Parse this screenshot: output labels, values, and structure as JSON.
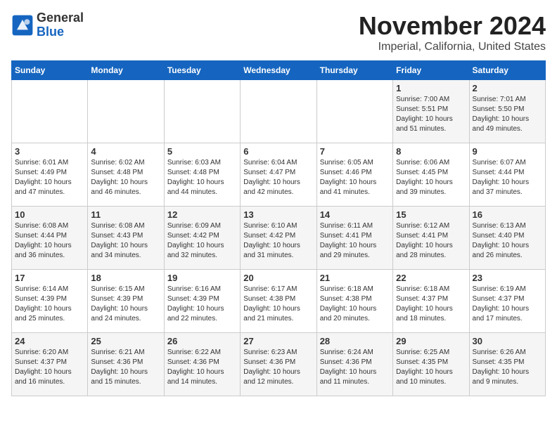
{
  "logo": {
    "line1": "General",
    "line2": "Blue"
  },
  "title": "November 2024",
  "location": "Imperial, California, United States",
  "days_of_week": [
    "Sunday",
    "Monday",
    "Tuesday",
    "Wednesday",
    "Thursday",
    "Friday",
    "Saturday"
  ],
  "weeks": [
    [
      {
        "day": "",
        "info": ""
      },
      {
        "day": "",
        "info": ""
      },
      {
        "day": "",
        "info": ""
      },
      {
        "day": "",
        "info": ""
      },
      {
        "day": "",
        "info": ""
      },
      {
        "day": "1",
        "info": "Sunrise: 7:00 AM\nSunset: 5:51 PM\nDaylight: 10 hours\nand 51 minutes."
      },
      {
        "day": "2",
        "info": "Sunrise: 7:01 AM\nSunset: 5:50 PM\nDaylight: 10 hours\nand 49 minutes."
      }
    ],
    [
      {
        "day": "3",
        "info": "Sunrise: 6:01 AM\nSunset: 4:49 PM\nDaylight: 10 hours\nand 47 minutes."
      },
      {
        "day": "4",
        "info": "Sunrise: 6:02 AM\nSunset: 4:48 PM\nDaylight: 10 hours\nand 46 minutes."
      },
      {
        "day": "5",
        "info": "Sunrise: 6:03 AM\nSunset: 4:48 PM\nDaylight: 10 hours\nand 44 minutes."
      },
      {
        "day": "6",
        "info": "Sunrise: 6:04 AM\nSunset: 4:47 PM\nDaylight: 10 hours\nand 42 minutes."
      },
      {
        "day": "7",
        "info": "Sunrise: 6:05 AM\nSunset: 4:46 PM\nDaylight: 10 hours\nand 41 minutes."
      },
      {
        "day": "8",
        "info": "Sunrise: 6:06 AM\nSunset: 4:45 PM\nDaylight: 10 hours\nand 39 minutes."
      },
      {
        "day": "9",
        "info": "Sunrise: 6:07 AM\nSunset: 4:44 PM\nDaylight: 10 hours\nand 37 minutes."
      }
    ],
    [
      {
        "day": "10",
        "info": "Sunrise: 6:08 AM\nSunset: 4:44 PM\nDaylight: 10 hours\nand 36 minutes."
      },
      {
        "day": "11",
        "info": "Sunrise: 6:08 AM\nSunset: 4:43 PM\nDaylight: 10 hours\nand 34 minutes."
      },
      {
        "day": "12",
        "info": "Sunrise: 6:09 AM\nSunset: 4:42 PM\nDaylight: 10 hours\nand 32 minutes."
      },
      {
        "day": "13",
        "info": "Sunrise: 6:10 AM\nSunset: 4:42 PM\nDaylight: 10 hours\nand 31 minutes."
      },
      {
        "day": "14",
        "info": "Sunrise: 6:11 AM\nSunset: 4:41 PM\nDaylight: 10 hours\nand 29 minutes."
      },
      {
        "day": "15",
        "info": "Sunrise: 6:12 AM\nSunset: 4:41 PM\nDaylight: 10 hours\nand 28 minutes."
      },
      {
        "day": "16",
        "info": "Sunrise: 6:13 AM\nSunset: 4:40 PM\nDaylight: 10 hours\nand 26 minutes."
      }
    ],
    [
      {
        "day": "17",
        "info": "Sunrise: 6:14 AM\nSunset: 4:39 PM\nDaylight: 10 hours\nand 25 minutes."
      },
      {
        "day": "18",
        "info": "Sunrise: 6:15 AM\nSunset: 4:39 PM\nDaylight: 10 hours\nand 24 minutes."
      },
      {
        "day": "19",
        "info": "Sunrise: 6:16 AM\nSunset: 4:39 PM\nDaylight: 10 hours\nand 22 minutes."
      },
      {
        "day": "20",
        "info": "Sunrise: 6:17 AM\nSunset: 4:38 PM\nDaylight: 10 hours\nand 21 minutes."
      },
      {
        "day": "21",
        "info": "Sunrise: 6:18 AM\nSunset: 4:38 PM\nDaylight: 10 hours\nand 20 minutes."
      },
      {
        "day": "22",
        "info": "Sunrise: 6:18 AM\nSunset: 4:37 PM\nDaylight: 10 hours\nand 18 minutes."
      },
      {
        "day": "23",
        "info": "Sunrise: 6:19 AM\nSunset: 4:37 PM\nDaylight: 10 hours\nand 17 minutes."
      }
    ],
    [
      {
        "day": "24",
        "info": "Sunrise: 6:20 AM\nSunset: 4:37 PM\nDaylight: 10 hours\nand 16 minutes."
      },
      {
        "day": "25",
        "info": "Sunrise: 6:21 AM\nSunset: 4:36 PM\nDaylight: 10 hours\nand 15 minutes."
      },
      {
        "day": "26",
        "info": "Sunrise: 6:22 AM\nSunset: 4:36 PM\nDaylight: 10 hours\nand 14 minutes."
      },
      {
        "day": "27",
        "info": "Sunrise: 6:23 AM\nSunset: 4:36 PM\nDaylight: 10 hours\nand 12 minutes."
      },
      {
        "day": "28",
        "info": "Sunrise: 6:24 AM\nSunset: 4:36 PM\nDaylight: 10 hours\nand 11 minutes."
      },
      {
        "day": "29",
        "info": "Sunrise: 6:25 AM\nSunset: 4:35 PM\nDaylight: 10 hours\nand 10 minutes."
      },
      {
        "day": "30",
        "info": "Sunrise: 6:26 AM\nSunset: 4:35 PM\nDaylight: 10 hours\nand 9 minutes."
      }
    ]
  ]
}
